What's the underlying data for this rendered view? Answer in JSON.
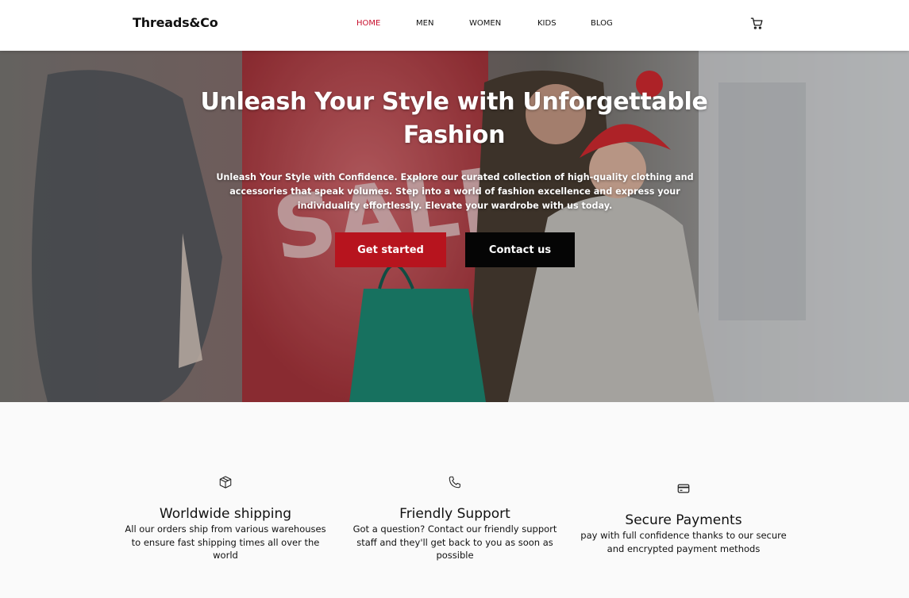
{
  "header": {
    "logo": "Threads&Co",
    "nav": [
      {
        "label": "HOME",
        "active": true
      },
      {
        "label": "MEN",
        "active": false
      },
      {
        "label": "WOMEN",
        "active": false
      },
      {
        "label": "KIDS",
        "active": false
      },
      {
        "label": "BLOG",
        "active": false
      }
    ],
    "cart_icon": "cart-icon"
  },
  "hero": {
    "title": "Unleash Your Style with Unforgettable Fashion",
    "subtitle": "Unleash Your Style with Confidence. Explore our curated collection of high-quality clothing and accessories that speak volumes. Step into a world of fashion excellence and express your individuality effortlessly. Elevate your wardrobe with us today.",
    "primary_button": "Get started",
    "secondary_button": "Contact us",
    "sign_text": "SALE"
  },
  "features": [
    {
      "icon": "box-icon",
      "title": "Worldwide shipping",
      "text": "All our orders ship from various warehouses to ensure fast shipping times all over the world"
    },
    {
      "icon": "phone-icon",
      "title": "Friendly Support",
      "text": "Got a question? Contact our friendly support staff and they'll get back to you as soon as possible"
    },
    {
      "icon": "credit-card-icon",
      "title": "Secure Payments",
      "text": "pay with full confidence thanks to our secure and encrypted payment methods"
    }
  ],
  "colors": {
    "accent": "#c8102e",
    "primary_button": "#b7141e",
    "secondary_button": "#050505"
  }
}
